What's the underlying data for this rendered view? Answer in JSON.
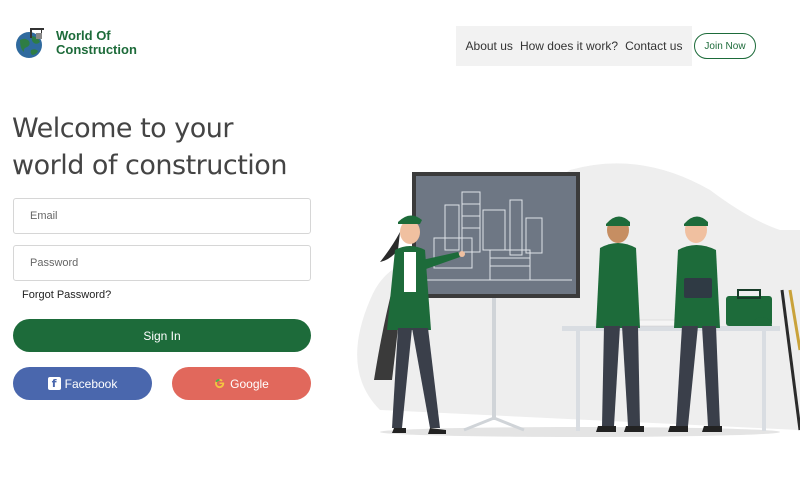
{
  "header": {
    "logo_line1": "World Of",
    "logo_line2": "Construction",
    "nav": {
      "about": "About us",
      "how": "How does it work?",
      "contact": "Contact us"
    },
    "join_label": "Join Now"
  },
  "hero": {
    "title_line1": "Welcome to your",
    "title_line2": "world of construction"
  },
  "form": {
    "email_placeholder": "Email",
    "password_placeholder": "Password",
    "forgot_label": "Forgot Password?",
    "signin_label": "Sign In",
    "facebook_label": "Facebook",
    "google_label": "Google"
  },
  "colors": {
    "brand_green": "#1d6b3a",
    "facebook_blue": "#4a67ad",
    "google_red": "#e1685c"
  },
  "icons": [
    "globe-logo-icon",
    "facebook-icon",
    "google-icon"
  ]
}
